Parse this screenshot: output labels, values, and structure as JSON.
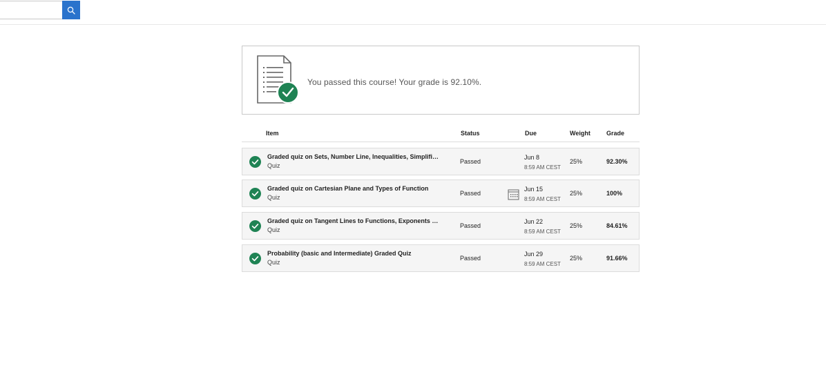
{
  "search": {
    "value": "",
    "placeholder": ""
  },
  "banner": {
    "message": "You passed this course! Your grade is 92.10%."
  },
  "table": {
    "headers": {
      "item": "Item",
      "status": "Status",
      "due": "Due",
      "weight": "Weight",
      "grade": "Grade"
    },
    "rows": [
      {
        "title": "Graded quiz on Sets, Number Line, Inequalities, Simplification, and Sigma Notation",
        "type": "Quiz",
        "status": "Passed",
        "due_date": "Jun 8",
        "due_time": "8:59 AM CEST",
        "weight": "25%",
        "grade": "92.30%",
        "calendar_icon": false
      },
      {
        "title": "Graded quiz on Cartesian Plane and Types of Function",
        "type": "Quiz",
        "status": "Passed",
        "due_date": "Jun 15",
        "due_time": "8:59 AM CEST",
        "weight": "25%",
        "grade": "100%",
        "calendar_icon": true
      },
      {
        "title": "Graded quiz on Tangent Lines to Functions, Exponents and Logarithms",
        "type": "Quiz",
        "status": "Passed",
        "due_date": "Jun 22",
        "due_time": "8:59 AM CEST",
        "weight": "25%",
        "grade": "84.61%",
        "calendar_icon": false
      },
      {
        "title": "Probability (basic and Intermediate) Graded Quiz",
        "type": "Quiz",
        "status": "Passed",
        "due_date": "Jun 29",
        "due_time": "8:59 AM CEST",
        "weight": "25%",
        "grade": "91.66%",
        "calendar_icon": false
      }
    ]
  },
  "colors": {
    "accent": "#2a73cc",
    "success": "#1f8354",
    "row_bg": "#f5f5f5"
  },
  "icons": {
    "search": "search-icon",
    "document": "document-icon",
    "check": "check-circle-icon",
    "calendar": "calendar-icon"
  }
}
